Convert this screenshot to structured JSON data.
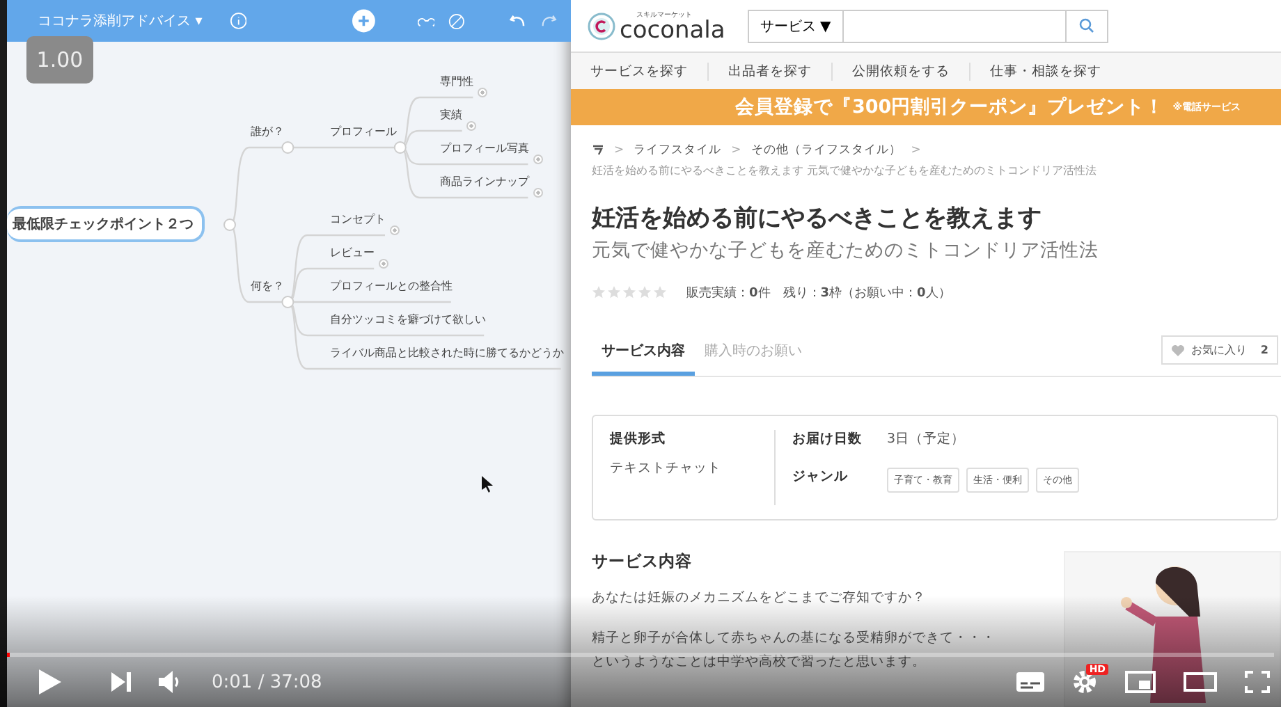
{
  "mindmap": {
    "toolbar": {
      "title": "ココナラ添削アドバイス",
      "caret": "▾"
    },
    "root": {
      "label": "最低限チェックポイント２つ",
      "children": [
        {
          "label": "誰が？",
          "children": [
            {
              "label": "プロフィール",
              "children": [
                {
                  "label": "専門性",
                  "marker": true
                },
                {
                  "label": "実績",
                  "marker": true
                },
                {
                  "label": "プロフィール写真",
                  "marker": true
                },
                {
                  "label": "商品ラインナップ",
                  "marker": true
                }
              ]
            }
          ]
        },
        {
          "label": "何を？",
          "children": [
            {
              "label": "コンセプト",
              "marker": true
            },
            {
              "label": "レビュー",
              "marker": true
            },
            {
              "label": "プロフィールとの整合性",
              "marker": false
            },
            {
              "label": "自分ツッコミを癖づけて欲しい",
              "marker": false
            },
            {
              "label": "ライバル商品と比較された時に勝てるかどうか",
              "marker": false
            }
          ]
        }
      ]
    }
  },
  "speed_badge": "1.00",
  "site": {
    "logo_caption": "スキルマーケット",
    "logo": "coconala",
    "search": {
      "category": "サービス ▼"
    },
    "nav": [
      "サービスを探す",
      "出品者を探す",
      "公開依頼をする",
      "仕事・相談を探す"
    ],
    "banner": {
      "text": "会員登録で『300円割引クーポン』プレゼント！",
      "note": "※電話サービス"
    },
    "breadcrumb": [
      {
        "kind": "separator",
        "text": ">"
      },
      {
        "kind": "link",
        "text": "ライフスタイル"
      },
      {
        "kind": "separator",
        "text": ">"
      },
      {
        "kind": "link",
        "text": "その他（ライフスタイル）"
      },
      {
        "kind": "separator",
        "text": ">"
      }
    ],
    "breadcrumb_title": "妊活を始める前にやるべきことを教えます 元気で健やかな子どもを産むためのミトコンドリア活性法",
    "title": "妊活を始める前にやるべきことを教えます",
    "subtitle": "元気で健やかな子どもを産むためのミトコンドリア活性法",
    "stars": 0,
    "stats": "販売実績：**0**件　残り：**3**枠（お願い中：**0**人）",
    "tabs": [
      {
        "label": "サービス内容",
        "selected": true
      },
      {
        "label": "購入時のお願い",
        "selected": false
      }
    ],
    "favorite": {
      "label": "お気に入り",
      "count": "2"
    },
    "info": {
      "format_label": "提供形式",
      "format_value": "テキストチャット",
      "delivery_label": "お届け日数",
      "delivery_value": "3日（予定）",
      "genre_label": "ジャンル",
      "genres": [
        "子育て・教育",
        "生活・便利",
        "その他"
      ]
    },
    "section_title": "サービス内容",
    "paragraphs": [
      "あなたは妊娠のメカニズムをどこまでご存知ですか？",
      "精子と卵子が合体して赤ちゃんの基になる受精卵ができて・・・",
      "というようなことは中学や高校で習ったと思います。"
    ]
  },
  "player": {
    "level": 0.002,
    "time": "0:01 / 37:08",
    "hd_badge": "HD"
  }
}
